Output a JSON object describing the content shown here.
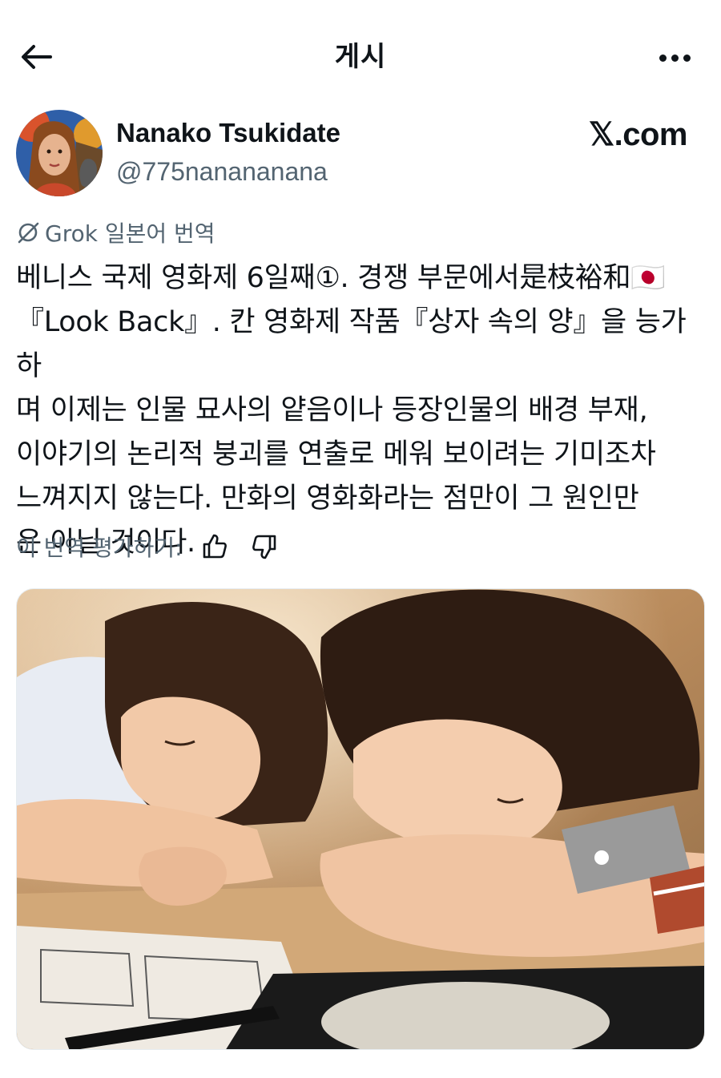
{
  "header": {
    "title": "게시",
    "back_icon": "arrow-left-icon",
    "more_icon": "more-horizontal-icon"
  },
  "author": {
    "name": "Nanako Tsukidate",
    "handle": "@775nanananana",
    "source": "𝕏.com"
  },
  "translation": {
    "icon": "grok-icon",
    "label": "Grok 일본어 번역"
  },
  "post": {
    "text": "베니스 국제 영화제 6일째①. 경쟁 부문에서是枝裕和🇯🇵\n『Look Back』. 칸 영화제 작품『상자 속의 양』을 능가하\n며 이제는 인물 묘사의 얕음이나 등장인물의 배경 부재,\n이야기의 논리적 붕괴를 연출로 메워 보이려는 기미조차\n느껴지지 않는다. 만화의 영화화라는 점만이 그 원인만\n은 아닐 것이다."
  },
  "rating": {
    "label": "이 번역 평가하기:",
    "up_icon": "thumbs-up-icon",
    "down_icon": "thumbs-down-icon"
  },
  "media": {
    "type": "photo",
    "colors": {
      "background": "#b98b5c",
      "hair": "#3a2417",
      "skin": "#f2c9a8",
      "paper": "#efeae2"
    }
  }
}
